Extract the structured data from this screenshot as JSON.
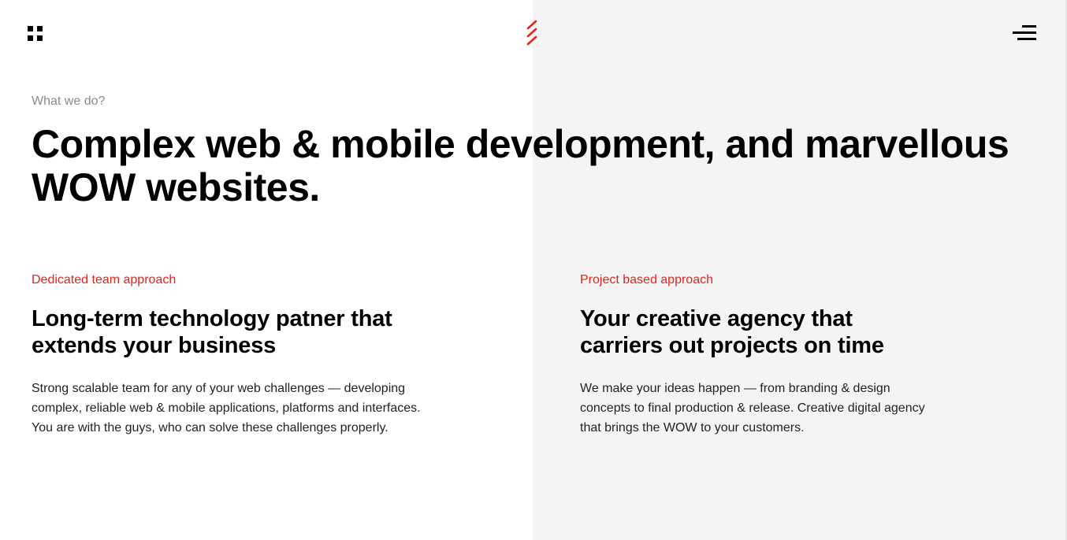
{
  "header": {
    "menu_icon": "grid-icon",
    "logo_icon": "slash-logo-icon",
    "nav_icon": "hamburger-icon"
  },
  "intro": {
    "eyebrow": "What we do?",
    "headline_line1": "Complex web & mobile development, and marvellous",
    "headline_line2": "WOW websites."
  },
  "columns": [
    {
      "label": "Dedicated team approach",
      "title_line1": "Long-term technology patner that",
      "title_line2": "extends your business",
      "text_line1": "Strong scalable team for any of your web challenges — developing",
      "text_line2": "complex, reliable web & mobile applications, platforms and interfaces.",
      "text_line3": "You are with the guys, who can solve these challenges properly."
    },
    {
      "label": "Project based approach",
      "title_line1": "Your creative agency that",
      "title_line2": "carriers out projects on time",
      "text_line1": "We make your ideas happen — from branding & design",
      "text_line2": "concepts to final production & release. Creative digital agency",
      "text_line3": "that brings the WOW to your customers."
    }
  ],
  "colors": {
    "accent": "#e1261c",
    "panel": "#f4f4f4",
    "text": "#000000",
    "muted": "#8a8a8a"
  }
}
